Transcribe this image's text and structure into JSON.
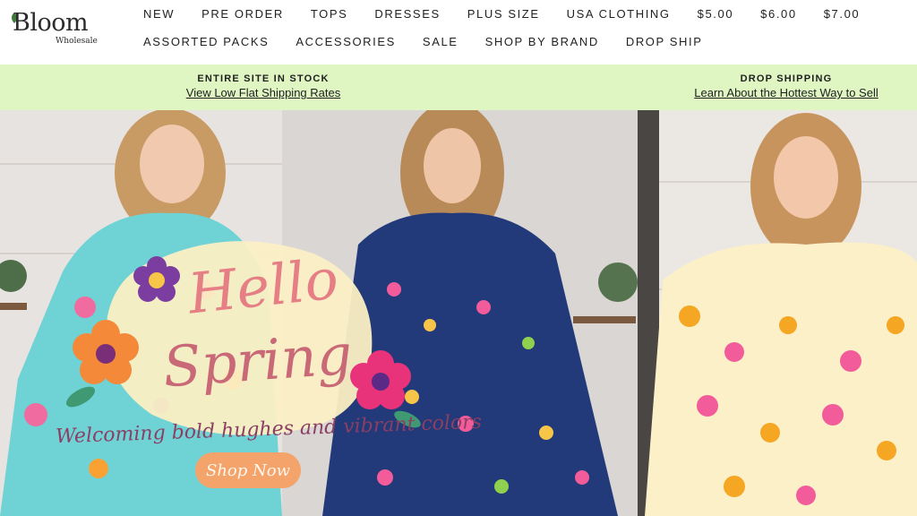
{
  "logo": {
    "name": "Bloom",
    "subtitle": "Wholesale"
  },
  "nav": {
    "row1": [
      "NEW",
      "PRE ORDER",
      "TOPS",
      "DRESSES",
      "PLUS SIZE",
      "USA CLOTHING",
      "$5.00",
      "$6.00",
      "$7.00"
    ],
    "row2": [
      "ASSORTED PACKS",
      "ACCESSORIES",
      "SALE",
      "SHOP BY BRAND",
      "DROP SHIP"
    ]
  },
  "promo": {
    "left": {
      "title": "ENTIRE SITE IN STOCK",
      "link": "View Low Flat Shipping Rates"
    },
    "right": {
      "title": "DROP SHIPPING",
      "link": "Learn About the Hottest Way to Sell"
    }
  },
  "hero": {
    "line1": "Hello",
    "line2": "Spring",
    "tagline": "Welcoming bold hughes and vibrant colors",
    "cta": "Shop Now"
  },
  "colors": {
    "promo_bg": "#dff5c2",
    "accent_pink": "#e57f85",
    "cta_orange": "#f4a36a"
  }
}
